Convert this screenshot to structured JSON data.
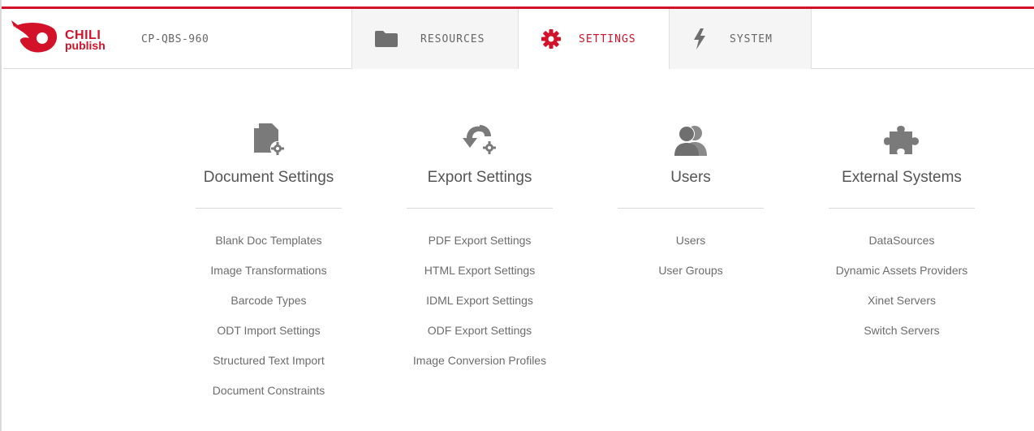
{
  "app": {
    "logo_line1": "CHILI",
    "logo_line2": "publish",
    "environment": "CP-QBS-960"
  },
  "brand": {
    "accent": "#d3122a",
    "icon_gray": "#777777"
  },
  "nav": {
    "tabs": [
      {
        "label": "RESOURCES",
        "icon": "folder-icon",
        "active": false
      },
      {
        "label": "SETTINGS",
        "icon": "gear-icon",
        "active": true
      },
      {
        "label": "SYSTEM",
        "icon": "lightning-icon",
        "active": false
      }
    ]
  },
  "sections": [
    {
      "title": "Document Settings",
      "icon": "document-settings-icon",
      "items": [
        "Blank Doc Templates",
        "Image Transformations",
        "Barcode Types",
        "ODT Import Settings",
        "Structured Text Import",
        "Document Constraints"
      ]
    },
    {
      "title": "Export Settings",
      "icon": "export-settings-icon",
      "items": [
        "PDF Export Settings",
        "HTML Export Settings",
        "IDML Export Settings",
        "ODF Export Settings",
        "Image Conversion Profiles"
      ]
    },
    {
      "title": "Users",
      "icon": "users-icon",
      "items": [
        "Users",
        "User Groups"
      ]
    },
    {
      "title": "External Systems",
      "icon": "puzzle-icon",
      "items": [
        "DataSources",
        "Dynamic Assets Providers",
        "Xinet Servers",
        "Switch Servers"
      ]
    }
  ]
}
